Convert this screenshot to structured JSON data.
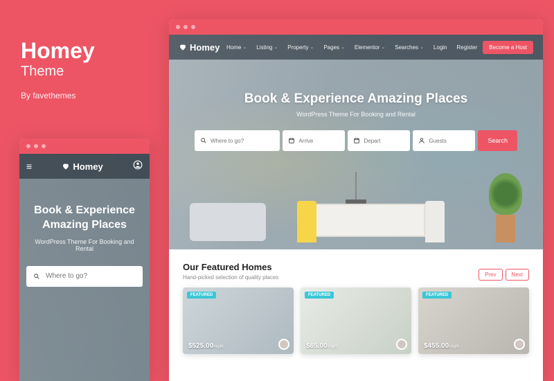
{
  "promo": {
    "title": "Homey",
    "subtitle": "Theme",
    "byline": "By favethemes"
  },
  "brand": "Homey",
  "nav": {
    "items": [
      "Home",
      "Listing",
      "Property",
      "Pages",
      "Elementor",
      "Searches"
    ],
    "login": "Login",
    "register": "Register",
    "cta": "Become a Host"
  },
  "hero": {
    "title": "Book & Experience Amazing Places",
    "subtitle": "WordPress Theme For Booking and Rental"
  },
  "search": {
    "where_ph": "Where to go?",
    "arrive_ph": "Arrive",
    "depart_ph": "Depart",
    "guests_ph": "Guests",
    "button": "Search"
  },
  "featured": {
    "title": "Our Featured Homes",
    "subtitle": "Hand-picked selection of quality places",
    "prev": "Prev",
    "next": "Next",
    "badge": "FEATURED",
    "per": "/night",
    "cards": [
      {
        "price": "$525.00"
      },
      {
        "price": "$65.00"
      },
      {
        "price": "$455.00"
      }
    ]
  },
  "colors": {
    "accent": "#ed5565",
    "badge": "#3ac7d6"
  }
}
